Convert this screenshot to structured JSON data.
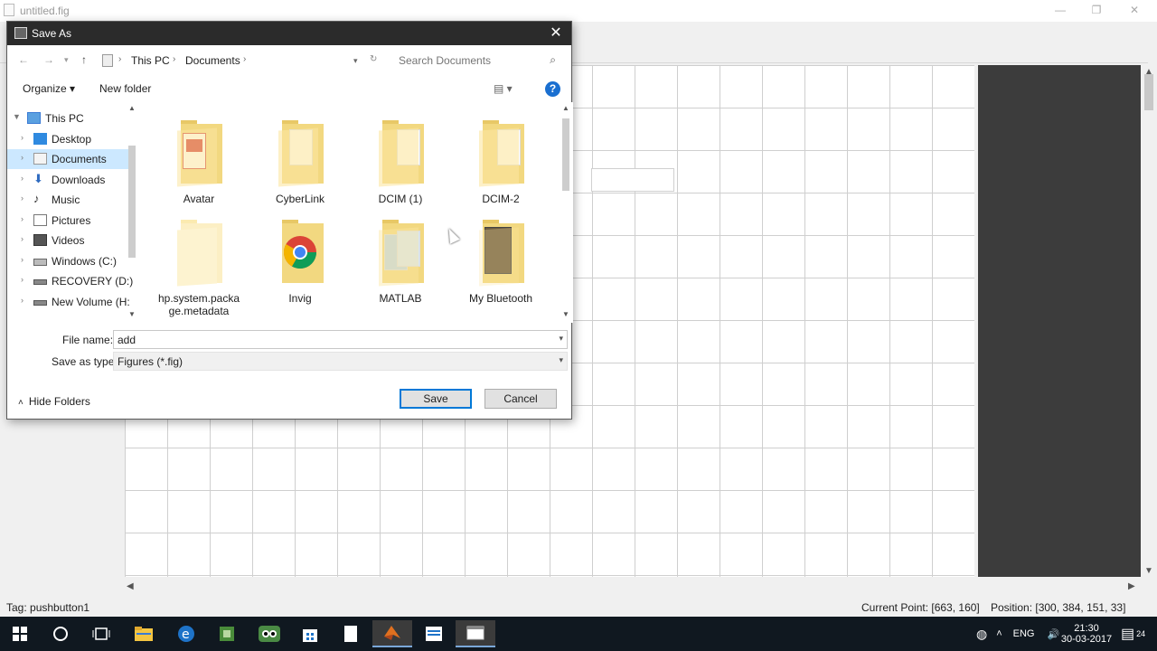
{
  "app": {
    "title": "untitled.fig",
    "controls": {
      "minimize": "—",
      "maximize": "❐",
      "close": "✕"
    }
  },
  "status": {
    "tag": "Tag: pushbutton1",
    "current_point": "Current Point:  [663, 160]",
    "position": "Position: [300, 384, 151, 33]"
  },
  "dialog": {
    "title": "Save As",
    "close": "✕",
    "breadcrumb": [
      "This PC",
      "Documents"
    ],
    "search_placeholder": "Search Documents",
    "organize": "Organize ▾",
    "new_folder": "New folder",
    "help": "?",
    "nav": [
      {
        "label": "This PC",
        "icon": "computer-icon"
      },
      {
        "label": "Desktop",
        "icon": "desktop-icon"
      },
      {
        "label": "Documents",
        "icon": "documents-icon",
        "selected": true
      },
      {
        "label": "Downloads",
        "icon": "downloads-icon"
      },
      {
        "label": "Music",
        "icon": "music-icon"
      },
      {
        "label": "Pictures",
        "icon": "pictures-icon"
      },
      {
        "label": "Videos",
        "icon": "videos-icon"
      },
      {
        "label": "Windows (C:)",
        "icon": "drive-icon"
      },
      {
        "label": "RECOVERY (D:)",
        "icon": "drive-icon"
      },
      {
        "label": "New Volume (H:",
        "icon": "drive-icon"
      }
    ],
    "files": [
      {
        "name": "Avatar",
        "icon": "folder-pdf-icon"
      },
      {
        "name": "CyberLink",
        "icon": "folder-icon"
      },
      {
        "name": "DCIM (1)",
        "icon": "folder-icon"
      },
      {
        "name": "DCIM-2",
        "icon": "folder-icon"
      },
      {
        "name": "hp.system.package.metadata",
        "name_line1": "hp.system.packa",
        "name_line2": "ge.metadata",
        "icon": "folder-empty-icon"
      },
      {
        "name": "Invig",
        "icon": "folder-chrome-icon"
      },
      {
        "name": "MATLAB",
        "icon": "folder-icon"
      },
      {
        "name": "My Bluetooth",
        "icon": "folder-photo-icon"
      }
    ],
    "file_name_label": "File name:",
    "file_name_value": "add",
    "save_type_label": "Save as type:",
    "save_type_value": "Figures (*.fig)",
    "hide_folders": "Hide Folders",
    "save": "Save",
    "cancel": "Cancel"
  },
  "taskbar": {
    "lang": "ENG",
    "time": "21:30",
    "date": "30-03-2017",
    "notifications": "24"
  },
  "colors": {
    "accent": "#0078d7",
    "selection": "#cce8ff",
    "taskbar": "#101820",
    "dialog_title": "#2b2b2b"
  }
}
